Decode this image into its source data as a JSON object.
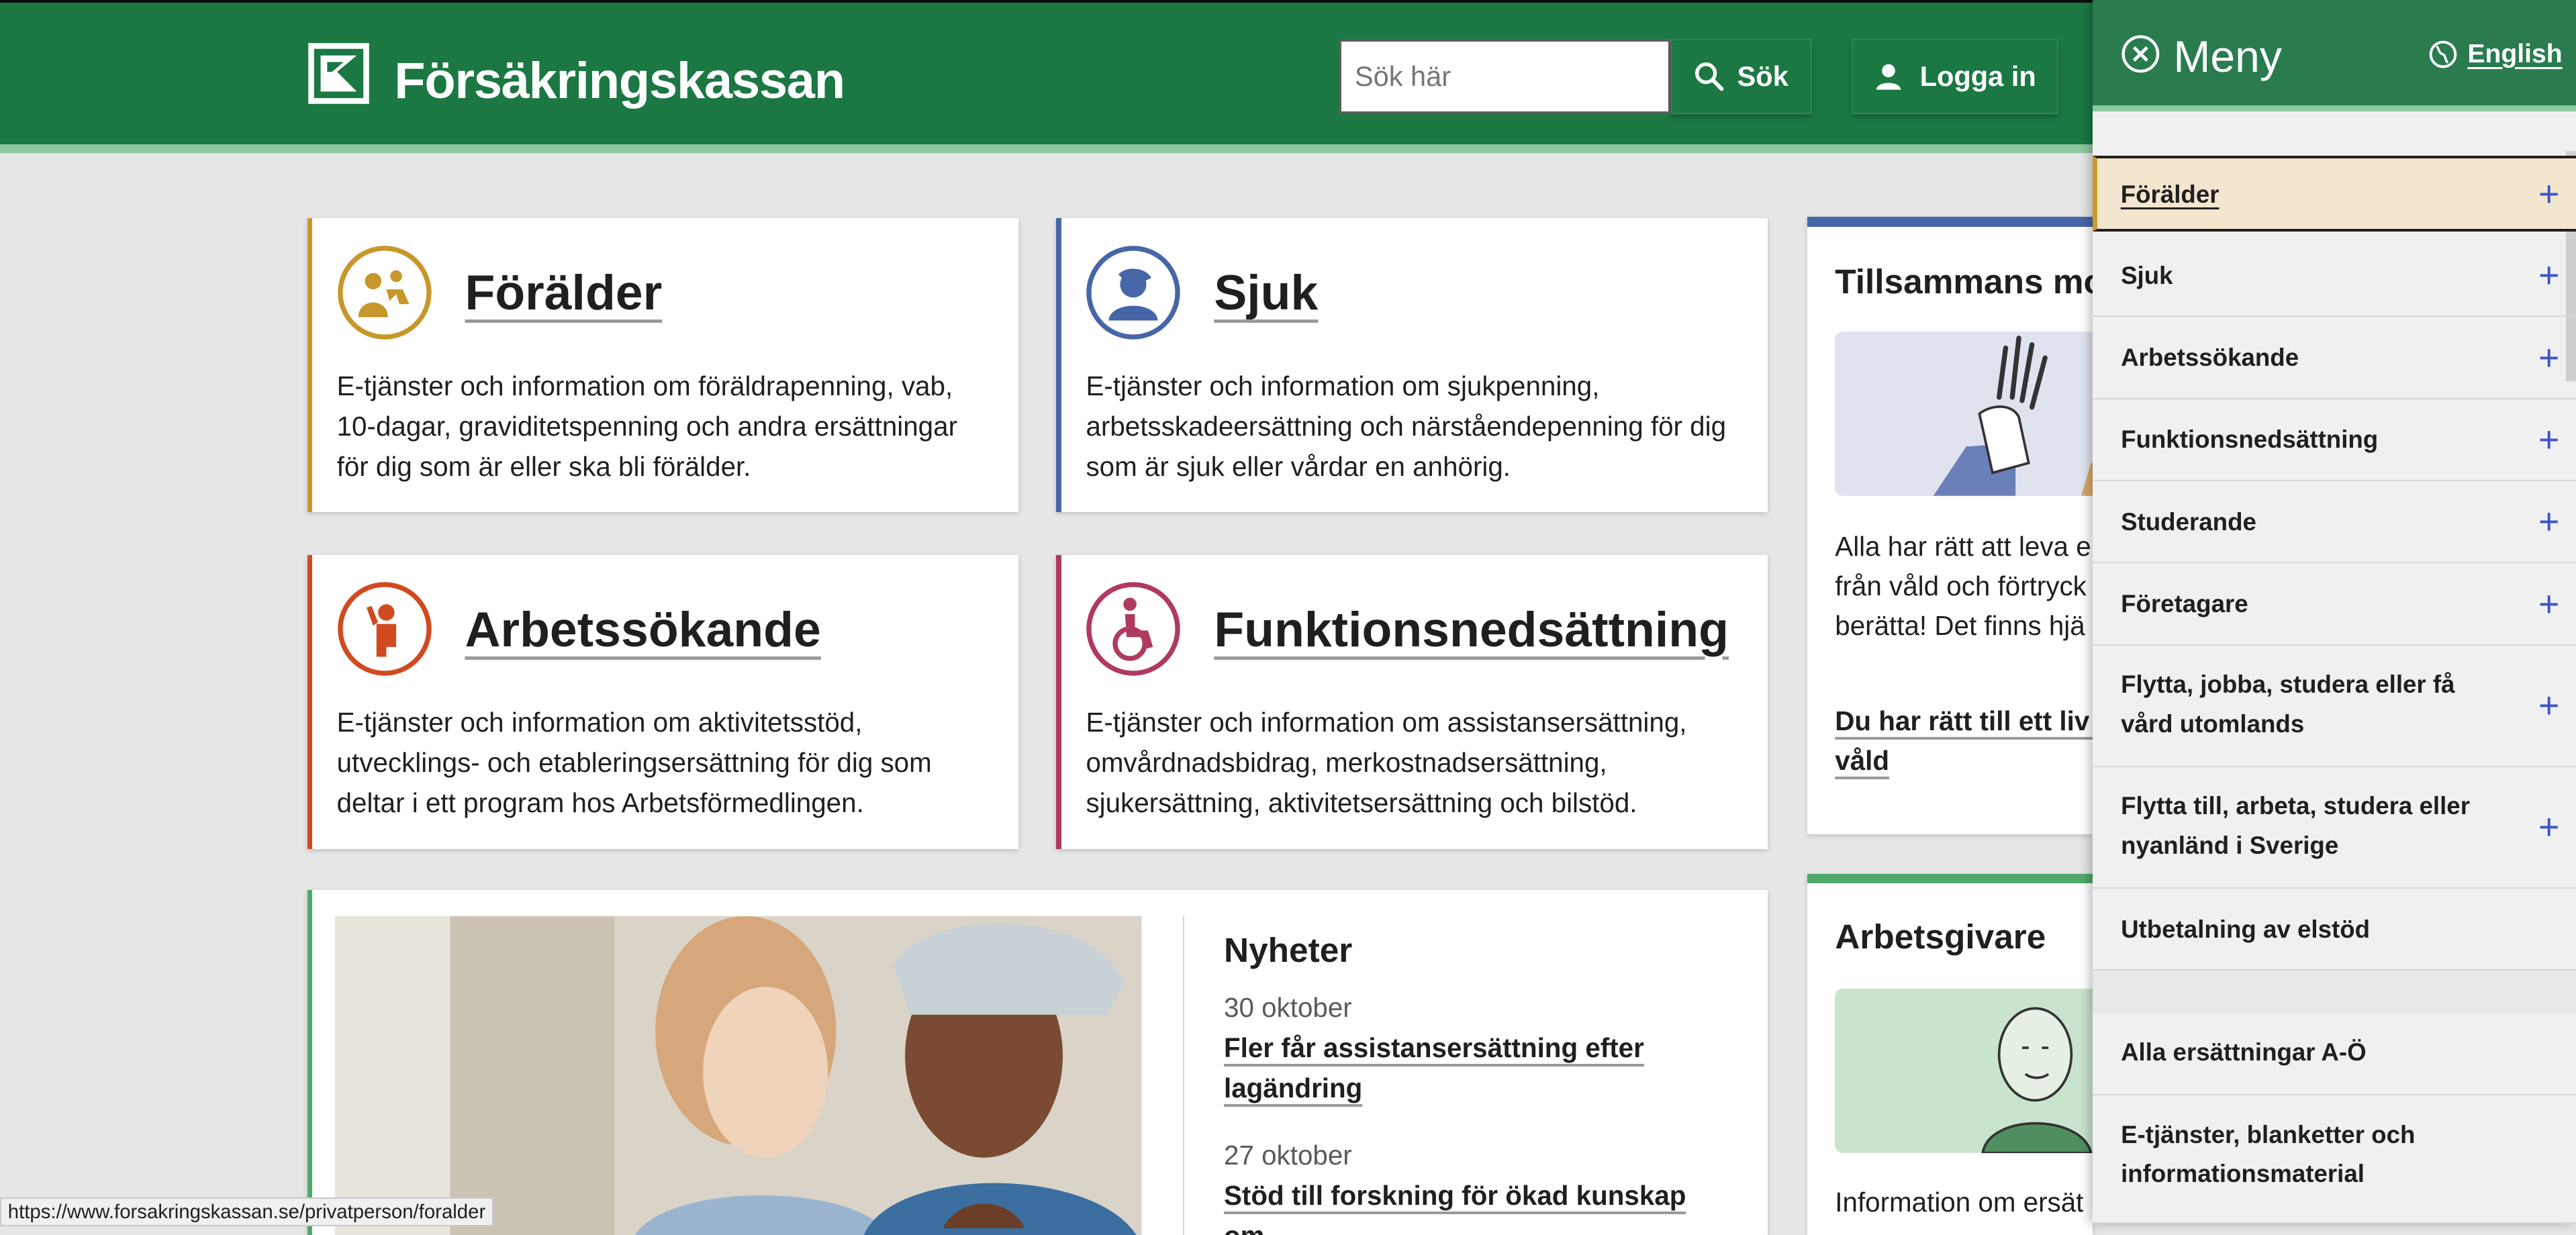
{
  "header": {
    "brand": "Försäkringskassan",
    "search_placeholder": "Sök här",
    "search_button": "Sök",
    "login_button": "Logga in",
    "bg_color": "#1b7843"
  },
  "cards": [
    {
      "title": "Förälder",
      "description": "E-tjänster och information om föräldrapenning, vab, 10-dagar, graviditetspenning och andra ersättningar för dig som är eller ska bli förälder.",
      "color": "#c8972b",
      "icon": "parent-child-icon"
    },
    {
      "title": "Sjuk",
      "description": "E-tjänster och information om sjukpenning, arbetsskadeersättning och närståendepenning för dig som är sjuk eller vårdar en anhörig.",
      "color": "#4766a8",
      "icon": "sick-person-icon"
    },
    {
      "title": "Arbetssökande",
      "description": "E-tjänster och information om aktivitetsstöd, utvecklings- och etableringsersättning för dig som deltar i ett program hos Arbetsförmedlingen.",
      "color": "#d14a1f",
      "icon": "job-seeker-icon"
    },
    {
      "title": "Funktionsnedsättning",
      "description": "E-tjänster och information om assistansersättning, omvårdnadsbidrag, merkostnadsersättning, sjukersättning, aktivitetsersättning och bilstöd.",
      "color": "#b03a5d",
      "icon": "wheelchair-icon"
    }
  ],
  "tillsammans": {
    "title": "Tillsammans mo",
    "text_lines": [
      "Alla har rätt att leva e",
      "från våld och förtryck",
      "berätta! Det finns hjä"
    ],
    "link_lines": [
      "Du har rätt till ett liv f",
      "våld"
    ]
  },
  "arbetsgivare": {
    "title": "Arbetsgivare",
    "text": "Information om ersät"
  },
  "news": {
    "heading": "Nyheter",
    "items": [
      {
        "date": "30 oktober",
        "title": "Fler får assistansersättning efter lagändring"
      },
      {
        "date": "27 oktober",
        "title": "Stöd till forskning för ökad kunskap om"
      }
    ]
  },
  "status_url": "https://www.forsakringskassan.se/privatperson/foralder",
  "menu": {
    "title": "Meny",
    "language": "English",
    "primary_items": [
      {
        "label": "Förälder",
        "expandable": true,
        "active": true
      },
      {
        "label": "Sjuk",
        "expandable": true
      },
      {
        "label": "Arbetssökande",
        "expandable": true
      },
      {
        "label": "Funktionsnedsättning",
        "expandable": true
      },
      {
        "label": "Studerande",
        "expandable": true
      },
      {
        "label": "Företagare",
        "expandable": true
      },
      {
        "label": "Flytta, jobba, studera eller få vård utomlands",
        "expandable": true
      },
      {
        "label": "Flytta till, arbeta, studera eller nyanländ i Sverige",
        "expandable": true
      },
      {
        "label": "Utbetalning av elstöd",
        "expandable": false
      }
    ],
    "secondary_items": [
      {
        "label": "Alla ersättningar A-Ö"
      },
      {
        "label": "E-tjänster, blanketter och informationsmaterial"
      }
    ],
    "expand_symbol": "+"
  }
}
